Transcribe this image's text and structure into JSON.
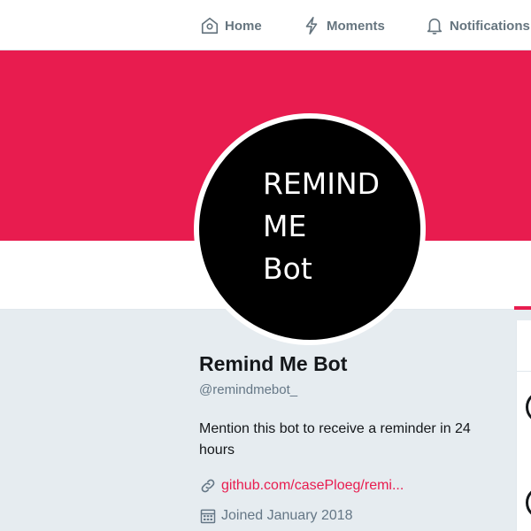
{
  "nav": {
    "home_label": "Home",
    "moments_label": "Moments",
    "notifications_label": "Notifications"
  },
  "profile": {
    "avatar_text": "REMIND\nME\nBot",
    "name": "Remind Me Bot",
    "handle": "@remindmebot_",
    "bio": "Mention this bot to receive a reminder in 24 hours",
    "url": "github.com/casePloeg/remi...",
    "joined": "Joined January 2018"
  },
  "icons": {
    "home": "home-icon",
    "moments": "lightning-icon",
    "notifications": "bell-icon",
    "link": "link-icon",
    "calendar": "calendar-icon"
  },
  "colors": {
    "accent": "#e81c4f",
    "avatar_background": "#000000",
    "page_background": "#e6ecf0",
    "text_secondary": "#657786"
  }
}
